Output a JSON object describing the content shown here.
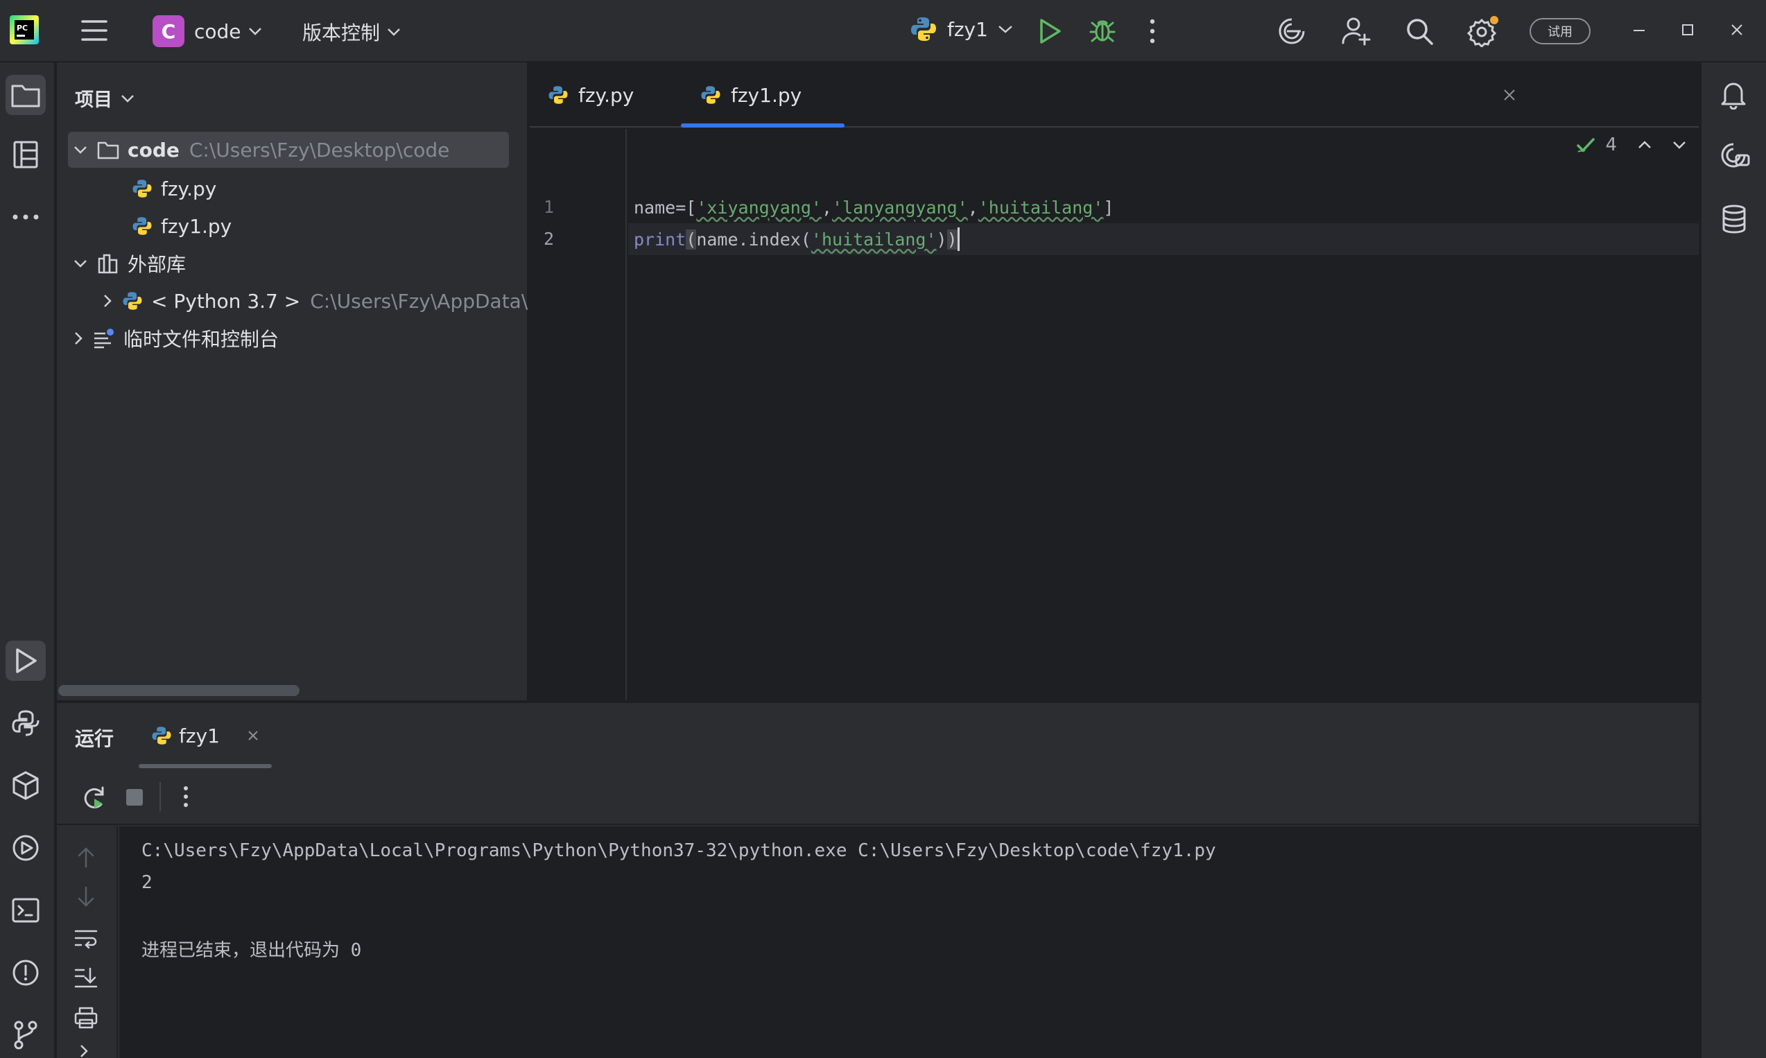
{
  "titlebar": {
    "project_badge": "C",
    "project_name": "code",
    "vcs_label": "版本控制",
    "run_config": "fzy1",
    "trial_label": "试用"
  },
  "project_panel": {
    "title": "项目",
    "tree": [
      {
        "label": "code",
        "path": "C:\\Users\\Fzy\\Desktop\\code"
      },
      {
        "label": "fzy.py"
      },
      {
        "label": "fzy1.py"
      },
      {
        "label": "外部库"
      },
      {
        "label": "< Python 3.7 >",
        "path": "C:\\Users\\Fzy\\AppData\\Lo"
      },
      {
        "label": "临时文件和控制台"
      }
    ]
  },
  "editor": {
    "tabs": [
      {
        "label": "fzy.py"
      },
      {
        "label": "fzy1.py"
      }
    ],
    "line_numbers": [
      "1",
      "2"
    ],
    "code": {
      "l1_a": "name=[",
      "l1_s1": "'xiyangyang'",
      "l1_c1": ",",
      "l1_s2": "'lanyangyang'",
      "l1_c2": ",",
      "l1_s3": "'huitailang'",
      "l1_b": "]",
      "l2_print": "print",
      "l2_open": "(",
      "l2_mid": "name.index(",
      "l2_s": "'huitailang'",
      "l2_close1": ")",
      "l2_close2": ")"
    },
    "inspection_count": "4"
  },
  "run_panel": {
    "title": "运行",
    "tab_label": "fzy1",
    "console_lines": [
      "C:\\Users\\Fzy\\AppData\\Local\\Programs\\Python\\Python37-32\\python.exe C:\\Users\\Fzy\\Desktop\\code\\fzy1.py",
      "2",
      "",
      "进程已结束，退出代码为 0"
    ]
  },
  "colors": {
    "accent": "#3574f0",
    "run_green": "#5fb865",
    "debug_green": "#5fb865",
    "project_badge": "#b84fc6",
    "string": "#6aab73",
    "builtin": "#8888c6"
  },
  "icons": {
    "titlebar": [
      "pycharm-logo-icon",
      "main-menu-icon",
      "chevron-down-icon",
      "python-icon",
      "run-icon",
      "debug-icon",
      "more-vertical-icon",
      "ai-assistant-icon",
      "add-user-icon",
      "search-icon",
      "settings-icon",
      "minimize-icon",
      "maximize-icon",
      "close-icon"
    ],
    "left_strip": [
      "project-folder-icon",
      "structure-icon",
      "more-horizontal-icon",
      "run-tool-icon",
      "python-console-icon",
      "python-packages-icon",
      "services-icon",
      "terminal-icon",
      "problems-icon",
      "git-icon"
    ],
    "right_strip": [
      "notifications-icon",
      "ai-chat-icon",
      "database-icon"
    ]
  }
}
